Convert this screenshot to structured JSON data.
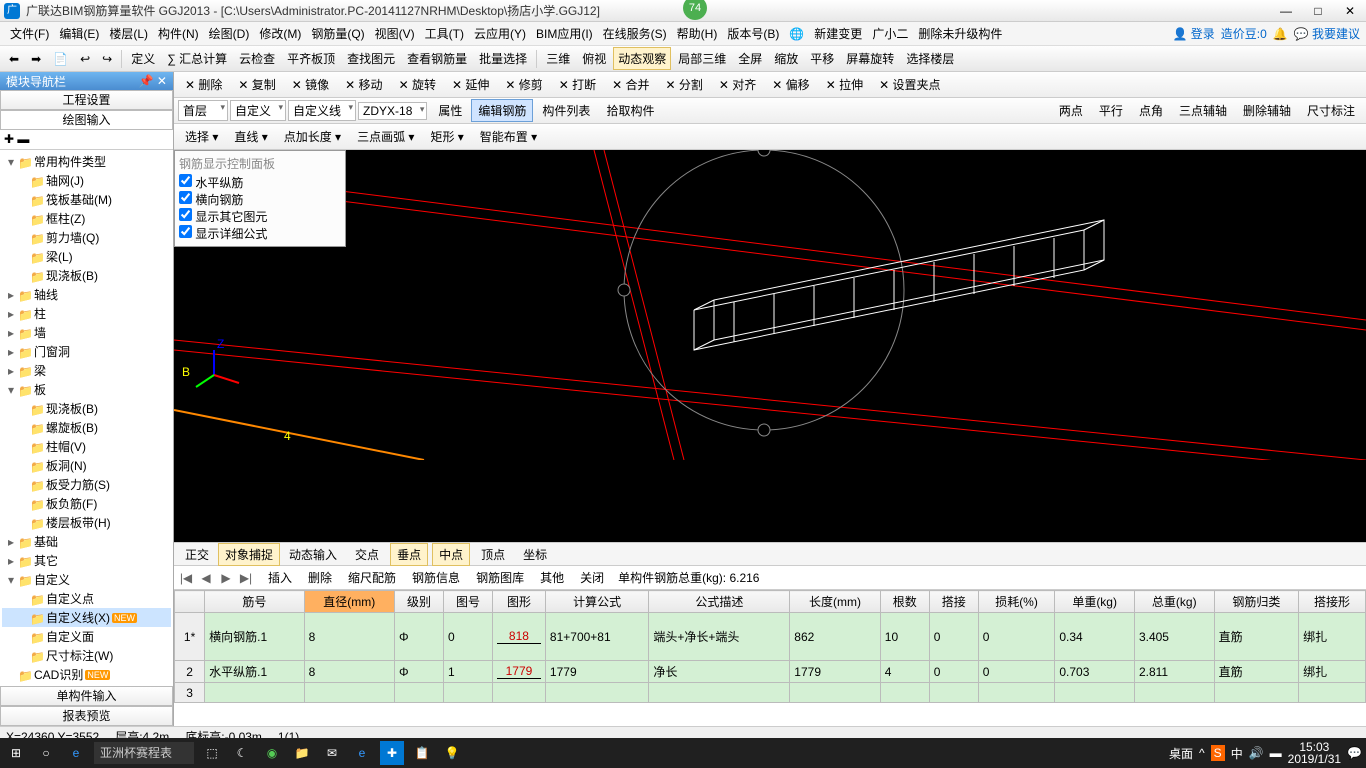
{
  "title_bar": {
    "app_name": "广联达BIM钢筋算量软件 GGJ2013 - [C:\\Users\\Administrator.PC-20141127NRHM\\Desktop\\扬店小学.GGJ12]",
    "badge": "74"
  },
  "menu": {
    "items": [
      "文件(F)",
      "编辑(E)",
      "楼层(L)",
      "构件(N)",
      "绘图(D)",
      "修改(M)",
      "钢筋量(Q)",
      "视图(V)",
      "工具(T)",
      "云应用(Y)",
      "BIM应用(I)",
      "在线服务(S)",
      "帮助(H)",
      "版本号(B)"
    ],
    "extra": [
      "新建变更",
      "广小二",
      "删除未升级构件"
    ],
    "right": {
      "login": "登录",
      "coin": "造价豆:0",
      "suggest": "我要建议"
    }
  },
  "toolbar1": {
    "items": [
      "定义",
      "∑ 汇总计算",
      "云检查",
      "平齐板顶",
      "查找图元",
      "查看钢筋量",
      "批量选择"
    ],
    "view": [
      "三维",
      "俯视",
      "动态观察",
      "局部三维",
      "全屏",
      "缩放",
      "平移",
      "屏幕旋转",
      "选择楼层"
    ]
  },
  "edit_bar": {
    "row1": [
      "删除",
      "复制",
      "镜像",
      "移动",
      "旋转",
      "延伸",
      "修剪",
      "打断",
      "合并",
      "分割",
      "对齐",
      "偏移",
      "拉伸",
      "设置夹点"
    ],
    "row2": {
      "floor": "首层",
      "custom": "自定义",
      "custom_line": "自定义线",
      "code": "ZDYX-18",
      "btns": [
        "属性",
        "编辑钢筋",
        "构件列表",
        "拾取构件"
      ],
      "aux": [
        "两点",
        "平行",
        "点角",
        "三点辅轴",
        "删除辅轴",
        "尺寸标注"
      ]
    },
    "row3": [
      "选择",
      "直线",
      "点加长度",
      "三点画弧",
      "矩形",
      "智能布置"
    ]
  },
  "nav": {
    "title": "模块导航栏",
    "tabs": [
      "工程设置",
      "绘图输入"
    ],
    "tree": [
      {
        "l": 0,
        "t": "常用构件类型",
        "exp": "▾"
      },
      {
        "l": 1,
        "t": "轴网(J)"
      },
      {
        "l": 1,
        "t": "筏板基础(M)"
      },
      {
        "l": 1,
        "t": "框柱(Z)"
      },
      {
        "l": 1,
        "t": "剪力墙(Q)"
      },
      {
        "l": 1,
        "t": "梁(L)"
      },
      {
        "l": 1,
        "t": "现浇板(B)"
      },
      {
        "l": 0,
        "t": "轴线",
        "exp": "▸"
      },
      {
        "l": 0,
        "t": "柱",
        "exp": "▸"
      },
      {
        "l": 0,
        "t": "墙",
        "exp": "▸"
      },
      {
        "l": 0,
        "t": "门窗洞",
        "exp": "▸"
      },
      {
        "l": 0,
        "t": "梁",
        "exp": "▸"
      },
      {
        "l": 0,
        "t": "板",
        "exp": "▾"
      },
      {
        "l": 1,
        "t": "现浇板(B)"
      },
      {
        "l": 1,
        "t": "螺旋板(B)"
      },
      {
        "l": 1,
        "t": "柱帽(V)"
      },
      {
        "l": 1,
        "t": "板洞(N)"
      },
      {
        "l": 1,
        "t": "板受力筋(S)"
      },
      {
        "l": 1,
        "t": "板负筋(F)"
      },
      {
        "l": 1,
        "t": "楼层板带(H)"
      },
      {
        "l": 0,
        "t": "基础",
        "exp": "▸"
      },
      {
        "l": 0,
        "t": "其它",
        "exp": "▸"
      },
      {
        "l": 0,
        "t": "自定义",
        "exp": "▾"
      },
      {
        "l": 1,
        "t": "自定义点"
      },
      {
        "l": 1,
        "t": "自定义线(X)",
        "sel": true,
        "new": true
      },
      {
        "l": 1,
        "t": "自定义面"
      },
      {
        "l": 1,
        "t": "尺寸标注(W)"
      },
      {
        "l": 0,
        "t": "CAD识别",
        "new": true
      }
    ],
    "bottom": [
      "单构件输入",
      "报表预览"
    ]
  },
  "rebar_panel": {
    "title": "钢筋显示控制面板",
    "opts": [
      "水平纵筋",
      "横向钢筋",
      "显示其它图元",
      "显示详细公式"
    ]
  },
  "snap": {
    "items": [
      "正交",
      "对象捕捉",
      "动态输入",
      "交点",
      "垂点",
      "中点",
      "顶点",
      "坐标"
    ]
  },
  "data_bar": {
    "btns": [
      "插入",
      "删除",
      "缩尺配筋",
      "钢筋信息",
      "钢筋图库",
      "其他",
      "关闭"
    ],
    "total_label": "单构件钢筋总重(kg):",
    "total_value": "6.216"
  },
  "grid": {
    "headers": [
      "",
      "筋号",
      "直径(mm)",
      "级别",
      "图号",
      "图形",
      "计算公式",
      "公式描述",
      "长度(mm)",
      "根数",
      "搭接",
      "损耗(%)",
      "单重(kg)",
      "总重(kg)",
      "钢筋归类",
      "搭接形"
    ],
    "rows": [
      {
        "n": "1*",
        "name": "横向钢筋.1",
        "dia": "8",
        "grade": "Φ",
        "fig": "0",
        "shape": "818",
        "formula": "81+700+81",
        "desc": "端头+净长+端头",
        "len": "862",
        "count": "10",
        "lap": "0",
        "loss": "0",
        "unit": "0.34",
        "total": "3.405",
        "cat": "直筋",
        "tie": "绑扎"
      },
      {
        "n": "2",
        "name": "水平纵筋.1",
        "dia": "8",
        "grade": "Φ",
        "fig": "1",
        "shape": "1779",
        "formula": "1779",
        "desc": "净长",
        "len": "1779",
        "count": "4",
        "lap": "0",
        "loss": "0",
        "unit": "0.703",
        "total": "2.811",
        "cat": "直筋",
        "tie": "绑扎"
      },
      {
        "n": "3",
        "name": "",
        "dia": "",
        "grade": "",
        "fig": "",
        "shape": "",
        "formula": "",
        "desc": "",
        "len": "",
        "count": "",
        "lap": "",
        "loss": "",
        "unit": "",
        "total": "",
        "cat": "",
        "tie": ""
      }
    ]
  },
  "status": {
    "coord": "X=24360 Y=3552",
    "floor": "层高:4.2m",
    "elev": "底标高:-0.03m",
    "sel": "1(1)"
  },
  "taskbar": {
    "search": "亚洲杯赛程表",
    "desktop": "桌面",
    "time": "15:03",
    "date": "2019/1/31",
    "ime": "中"
  }
}
